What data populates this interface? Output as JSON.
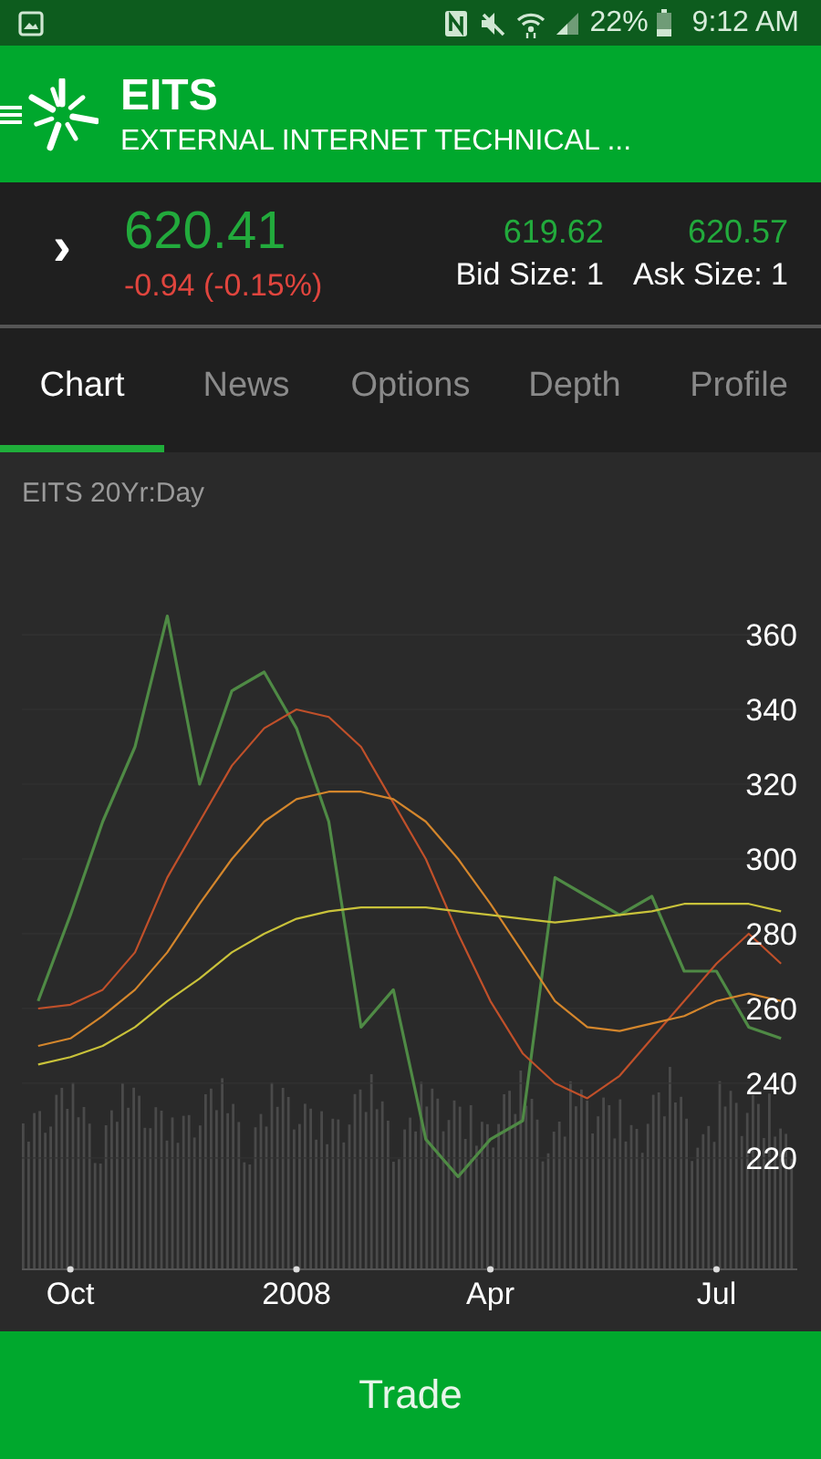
{
  "status_bar": {
    "battery": "22%",
    "time": "9:12 AM"
  },
  "header": {
    "symbol": "EITS",
    "name": "EXTERNAL INTERNET TECHNICAL ..."
  },
  "quote": {
    "expander": "›",
    "last": "620.41",
    "change": "-0.94 (-0.15%)",
    "bid": "619.62",
    "bid_size": "Bid Size: 1",
    "ask": "620.57",
    "ask_size": "Ask Size: 1"
  },
  "tabs": [
    {
      "label": "Chart",
      "selected": true
    },
    {
      "label": "News",
      "selected": false
    },
    {
      "label": "Options",
      "selected": false
    },
    {
      "label": "Depth",
      "selected": false
    },
    {
      "label": "Profile",
      "selected": false
    }
  ],
  "chart": {
    "chart_data": {
      "type": "line",
      "title": "EITS 20Yr:Day",
      "categories": [
        null,
        "Oct",
        null,
        null,
        null,
        null,
        null,
        null,
        "2008",
        null,
        null,
        null,
        null,
        null,
        "Apr",
        null,
        null,
        null,
        null,
        null,
        null,
        "Jul",
        null,
        null
      ],
      "ylim": [
        174.6,
        408.8
      ],
      "grid": true,
      "yticks": [
        220,
        240,
        260,
        280,
        300,
        320,
        340,
        360
      ],
      "series": [
        {
          "color": "#4f8a45",
          "values": [
            262,
            285,
            310,
            330,
            365,
            320,
            345,
            350,
            335,
            310,
            255,
            265,
            225,
            215,
            225,
            230,
            295,
            290,
            285,
            290,
            270,
            270,
            255,
            252
          ]
        },
        {
          "color": "#c0502a",
          "values": [
            260,
            261,
            265,
            275,
            295,
            310,
            325,
            335,
            340,
            338,
            330,
            315,
            300,
            280,
            262,
            248,
            240,
            236,
            242,
            252,
            262,
            272,
            280,
            272
          ]
        },
        {
          "color": "#d4862c",
          "values": [
            250,
            252,
            258,
            265,
            275,
            288,
            300,
            310,
            316,
            318,
            318,
            316,
            310,
            300,
            288,
            275,
            262,
            255,
            254,
            256,
            258,
            262,
            264,
            262
          ]
        },
        {
          "color": "#c9c23a",
          "values": [
            245,
            247,
            250,
            255,
            262,
            268,
            275,
            280,
            284,
            286,
            287,
            287,
            287,
            286,
            285,
            284,
            283,
            284,
            285,
            286,
            288,
            288,
            288,
            286
          ]
        }
      ]
    }
  },
  "trade_button": {
    "label": "Trade"
  }
}
